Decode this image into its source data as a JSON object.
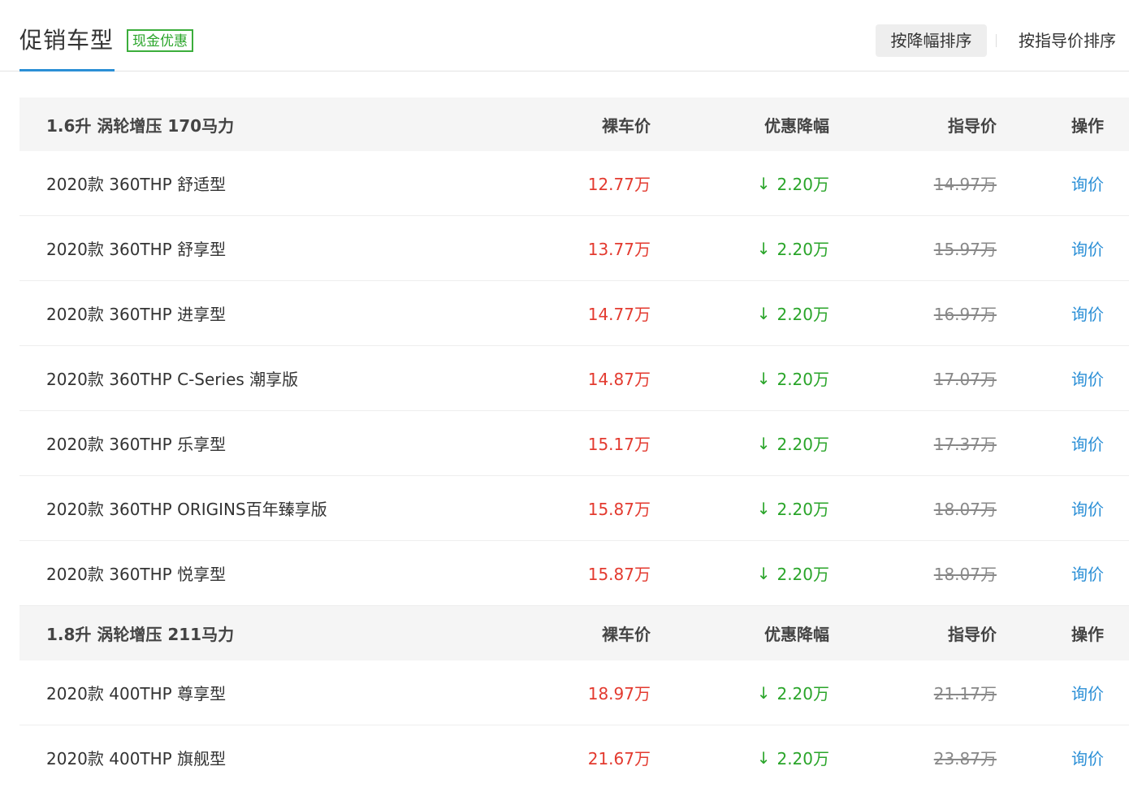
{
  "header": {
    "title": "促销车型",
    "badge": "现金优惠",
    "sort_by_drop": "按降幅排序",
    "sort_by_guide": "按指导价排序"
  },
  "columns": {
    "price": "裸车价",
    "drop": "优惠降幅",
    "guide": "指导价",
    "op": "操作"
  },
  "colors": {
    "price": "#e33a2f",
    "drop": "#2aa52a",
    "link": "#2b8fd6",
    "accent": "#2b8fd6"
  },
  "groups": [
    {
      "engine": "1.6升 涡轮增压 170马力",
      "rows": [
        {
          "name": "2020款 360THP 舒适型",
          "price": "12.77万",
          "drop": "2.20万",
          "guide": "14.97万",
          "op": "询价"
        },
        {
          "name": "2020款 360THP 舒享型",
          "price": "13.77万",
          "drop": "2.20万",
          "guide": "15.97万",
          "op": "询价"
        },
        {
          "name": "2020款 360THP 进享型",
          "price": "14.77万",
          "drop": "2.20万",
          "guide": "16.97万",
          "op": "询价"
        },
        {
          "name": "2020款 360THP C-Series 潮享版",
          "price": "14.87万",
          "drop": "2.20万",
          "guide": "17.07万",
          "op": "询价"
        },
        {
          "name": "2020款 360THP 乐享型",
          "price": "15.17万",
          "drop": "2.20万",
          "guide": "17.37万",
          "op": "询价"
        },
        {
          "name": "2020款 360THP ORIGINS百年臻享版",
          "price": "15.87万",
          "drop": "2.20万",
          "guide": "18.07万",
          "op": "询价"
        },
        {
          "name": "2020款 360THP 悦享型",
          "price": "15.87万",
          "drop": "2.20万",
          "guide": "18.07万",
          "op": "询价"
        }
      ]
    },
    {
      "engine": "1.8升 涡轮增压 211马力",
      "rows": [
        {
          "name": "2020款 400THP 尊享型",
          "price": "18.97万",
          "drop": "2.20万",
          "guide": "21.17万",
          "op": "询价"
        },
        {
          "name": "2020款 400THP 旗舰型",
          "price": "21.67万",
          "drop": "2.20万",
          "guide": "23.87万",
          "op": "询价"
        }
      ]
    }
  ]
}
